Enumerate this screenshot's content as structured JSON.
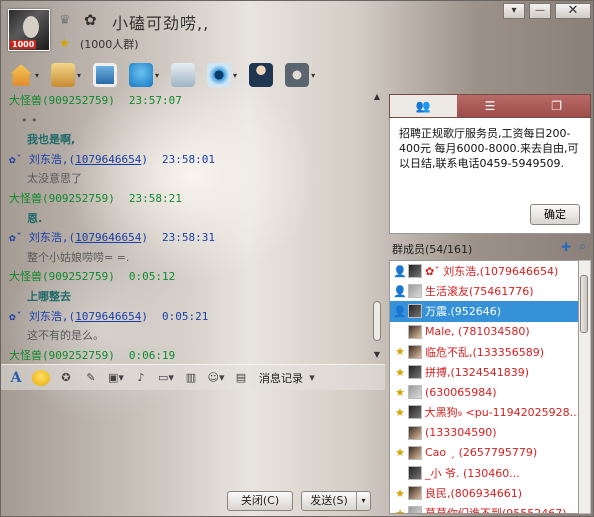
{
  "header": {
    "group_name": "小磕可劲唠,,",
    "member_capacity": "(1000人群)",
    "avatar_tag": "1000",
    "crown_icon": "crown-icon",
    "flower_icon": "flower-icon"
  },
  "window_buttons": {
    "menu": "▾",
    "minimize": "—",
    "close": "✕"
  },
  "toolbar": {
    "items": [
      {
        "icon": "home-icon",
        "arrow": "▾"
      },
      {
        "icon": "folder-icon",
        "arrow": "▾"
      },
      {
        "icon": "album-icon",
        "arrow": ""
      },
      {
        "icon": "voice-icon",
        "arrow": "▾"
      },
      {
        "icon": "add-app-icon",
        "arrow": ""
      },
      {
        "icon": "video-icon",
        "arrow": "▾"
      },
      {
        "icon": "manager-icon",
        "arrow": ""
      },
      {
        "icon": "settings-icon",
        "arrow": "▾"
      }
    ]
  },
  "chat": {
    "lines": [
      {
        "type": "header",
        "name": "大怪兽(909252759)",
        "time": "23:57:07",
        "color": "green"
      },
      {
        "type": "msg",
        "text": "•  •",
        "style": "dots"
      },
      {
        "type": "msg",
        "text": "我也是啊,",
        "style": "bold"
      },
      {
        "type": "header_link",
        "prefix": "✿ˇ    刘东浩,(",
        "id": "1079646654",
        "suffix": ")",
        "time": "23:58:01"
      },
      {
        "type": "msg",
        "text": "太没意思了",
        "style": ""
      },
      {
        "type": "header",
        "name": "大怪兽(909252759)",
        "time": "23:58:21",
        "color": "green"
      },
      {
        "type": "msg",
        "text": "恩.",
        "style": "bold"
      },
      {
        "type": "header_link",
        "prefix": "✿ˇ    刘东浩,(",
        "id": "1079646654",
        "suffix": ")",
        "time": "23:58:31"
      },
      {
        "type": "msg",
        "text": "整个小姑娘唠唠= =.",
        "style": ""
      },
      {
        "type": "header",
        "name": "大怪兽(909252759)",
        "time": "0:05:12",
        "color": "green"
      },
      {
        "type": "msg",
        "text": "上哪整去",
        "style": "bold"
      },
      {
        "type": "header_link",
        "prefix": "✿ˇ    刘东浩,(",
        "id": "1079646654",
        "suffix": ")",
        "time": "0:05:21"
      },
      {
        "type": "msg",
        "text": "这不有的是么。",
        "style": ""
      },
      {
        "type": "header",
        "name": "大怪兽(909252759)",
        "time": "0:06:19",
        "color": "green"
      },
      {
        "type": "msg",
        "text": "你唠吧",
        "style": "bold"
      }
    ],
    "scroll": {
      "up": "▲",
      "down": "▼"
    }
  },
  "input_toolbar": {
    "font_label": "A",
    "history_label": "消息记录",
    "history_arrow": "▾"
  },
  "footer": {
    "close_label": "关闭(C)",
    "send_label": "发送(S)",
    "send_arrow": "▾"
  },
  "announcement": {
    "tabs": [
      "👥",
      "☰",
      "❐"
    ],
    "text": "招聘正规歌厅服务员,工资每日200-400元 每月6000-8000.来去自由,可以日结,联系电话0459-5949509.",
    "confirm_label": "确定"
  },
  "members": {
    "title": "群成员(54/161)",
    "add_icon": "add-member-icon",
    "search_icon": "search-icon",
    "list": [
      {
        "badge": "👤",
        "name": "✿ˇ   刘东浩,(1079646654)",
        "avatar": "dark",
        "indent": false,
        "selected": false
      },
      {
        "badge": "👤",
        "name": "生活滚友(75461776)",
        "avatar": "grey",
        "indent": false,
        "selected": false
      },
      {
        "badge": "👤",
        "name": "万震.(952646)",
        "avatar": "dark",
        "indent": false,
        "selected": true
      },
      {
        "badge": "",
        "name": "Male, (781034580)",
        "avatar": "girl",
        "indent": true,
        "selected": false
      },
      {
        "badge": "★",
        "name": "临危不乱,(133356589)",
        "avatar": "girl",
        "indent": false,
        "selected": false
      },
      {
        "badge": "★",
        "name": "拼搏,(1324541839)",
        "avatar": "dark",
        "indent": false,
        "selected": false
      },
      {
        "badge": "★",
        "name": "(630065984)",
        "avatar": "grey",
        "indent": false,
        "selected": false
      },
      {
        "badge": "★",
        "name": "大黑狗₉ <pu-11942025928...",
        "avatar": "dark",
        "indent": false,
        "selected": false
      },
      {
        "badge": "",
        "name": "(133304590)",
        "avatar": "girl",
        "indent": true,
        "selected": false
      },
      {
        "badge": "★",
        "name": "Cao ˏ (2657795779)",
        "avatar": "girl",
        "indent": false,
        "selected": false
      },
      {
        "badge": "",
        "name": "_小  爷.  (130460...",
        "avatar": "dark",
        "indent": true,
        "selected": false
      },
      {
        "badge": "★",
        "name": "良民,(806934661)",
        "avatar": "girl",
        "indent": false,
        "selected": false
      },
      {
        "badge": "★",
        "name": "莫莫你们谁不到(95552467)",
        "avatar": "grey",
        "indent": false,
        "selected": false
      }
    ]
  }
}
